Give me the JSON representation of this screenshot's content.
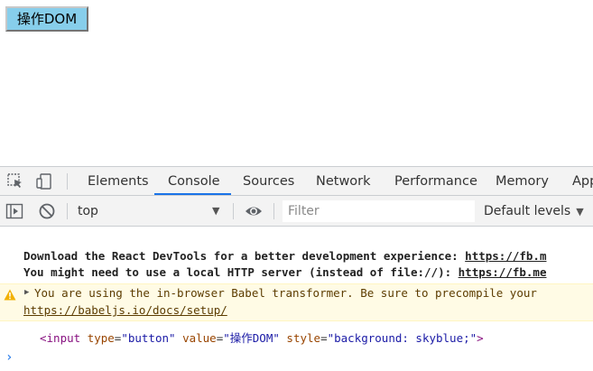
{
  "page": {
    "button_label": "操作DOM",
    "button_color": "#87ceeb"
  },
  "devtools": {
    "tabs": [
      "Elements",
      "Console",
      "Sources",
      "Network",
      "Performance",
      "Memory",
      "App"
    ],
    "active_tab": "Console",
    "accent": "#1a73e8",
    "toolbar": {
      "context": "top",
      "filter_placeholder": "Filter",
      "levels": "Default levels"
    },
    "icons": [
      "inspect-element-icon",
      "device-toolbar-icon",
      "sidebar-toggle-icon",
      "clear-console-icon",
      "eye-icon",
      "dropdown-caret-icon",
      "warning-icon",
      "expand-arrow-icon",
      "prompt-chevron-icon"
    ]
  },
  "console": {
    "messages": [
      {
        "text": "Download the React DevTools for a better development experience: ",
        "url": "https://fb.m"
      },
      {
        "text": "You might need to use a local HTTP server (instead of file://): ",
        "url": "https://fb.me"
      }
    ],
    "warning": {
      "line1": "You are using the in-browser Babel transformer. Be sure to precompile your",
      "link": "https://babeljs.io/docs/setup/"
    },
    "log": {
      "open": "<input",
      "type_attr": "type",
      "type_val": "\"button\"",
      "value_attr": "value",
      "value_val": "\"操作DOM\"",
      "style_attr": "style",
      "style_val": "\"background: skyblue;\"",
      "close": ">",
      "equals": "="
    }
  }
}
